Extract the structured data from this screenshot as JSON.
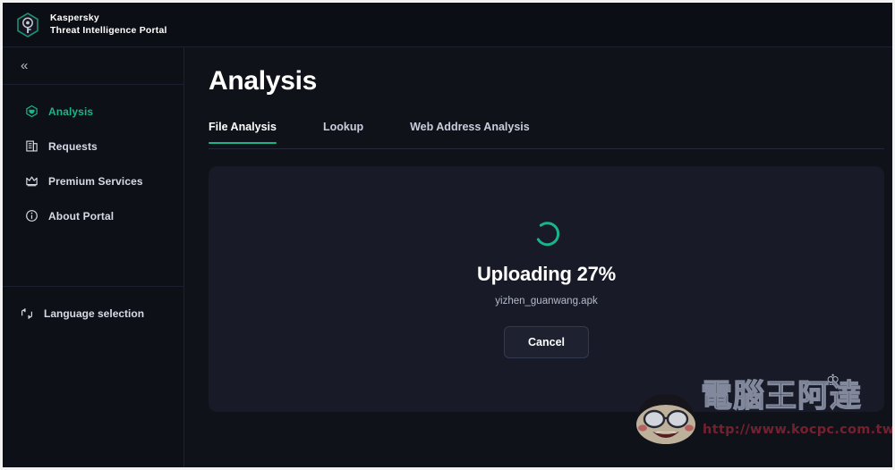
{
  "brand": {
    "logo_icon": "kaspersky-hexagon-logo",
    "line1": "Kaspersky",
    "line2": "Threat Intelligence Portal"
  },
  "sidebar": {
    "collapse_icon": "chevron-double-left-icon",
    "collapse_label": "«",
    "items": [
      {
        "label": "Analysis",
        "icon": "cube-icon",
        "active": true
      },
      {
        "label": "Requests",
        "icon": "document-list-icon",
        "active": false
      },
      {
        "label": "Premium Services",
        "icon": "crown-icon",
        "active": false
      },
      {
        "label": "About Portal",
        "icon": "info-circle-icon",
        "active": false
      }
    ],
    "language": {
      "label": "Language selection",
      "icon": "translate-arrows-icon"
    }
  },
  "main": {
    "title": "Analysis",
    "tabs": [
      {
        "label": "File Analysis",
        "active": true
      },
      {
        "label": "Lookup",
        "active": false
      },
      {
        "label": "Web Address Analysis",
        "active": false
      }
    ],
    "upload": {
      "spinner_icon": "loading-spinner-icon",
      "status": "Uploading 27%",
      "progress_percent": 27,
      "filename": "yizhen_guanwang.apk",
      "cancel_label": "Cancel"
    }
  },
  "watermark": {
    "face_icon": "cartoon-face-icon",
    "crown_icon": "crown-icon",
    "text": "電腦王阿達",
    "url": "http://www.kocpc.com.tw"
  },
  "colors": {
    "accent": "#18b58a",
    "page_bg": "#10121a",
    "sidebar_bg": "#0e1017",
    "topbar_bg": "#0c0e15",
    "panel_bg": "#181b27"
  }
}
